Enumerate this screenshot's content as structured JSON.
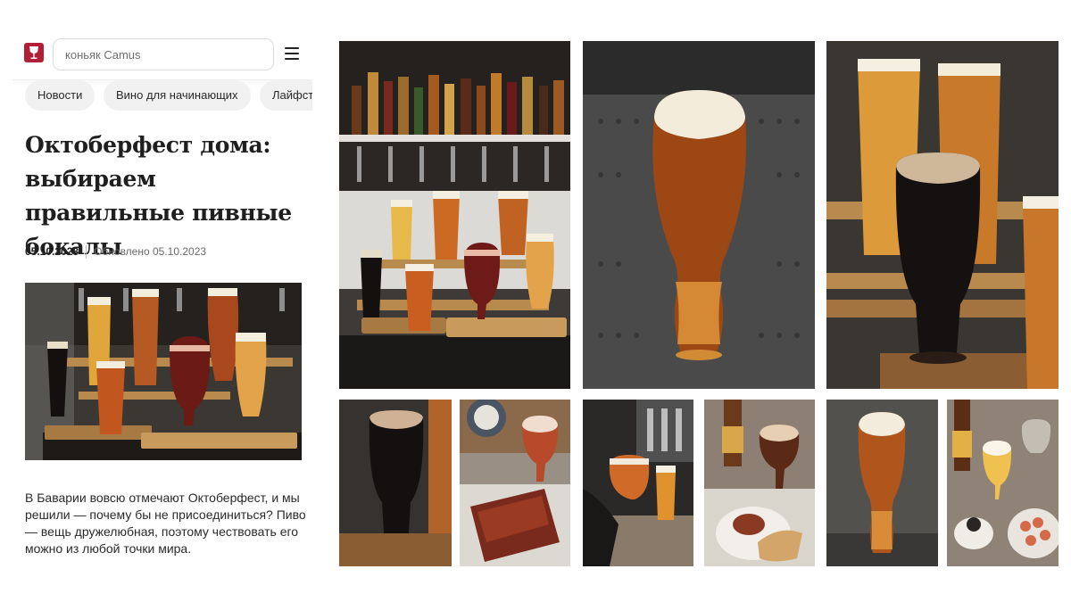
{
  "header": {
    "search_placeholder": "коньяк Camus"
  },
  "chips": [
    "Новости",
    "Вино для начинающих",
    "Лайфст"
  ],
  "article": {
    "title": "Октоберфест дома: выбираем правильные пивные бокалы",
    "date": "05.10.2023",
    "updated": "Обновлено 05.10.2023",
    "lead": "В Баварии вовсю отмечают Октоберфест, и мы решили — почему бы не присоединиться? Пиво — вещь дружелюбная, поэтому чествовать его можно из любой точки мира."
  },
  "colors": {
    "brand": "#b21e35",
    "chip_bg": "#f1f1f1",
    "stout": "#1a1210",
    "amber": "#a4541c",
    "lager": "#e3a73a",
    "foam": "#f4ecd8",
    "wood": "#b98a4e",
    "steel": "#4a4a4a"
  },
  "icons": {
    "logo": "wine-glass-logo-icon",
    "menu": "hamburger-menu-icon"
  }
}
